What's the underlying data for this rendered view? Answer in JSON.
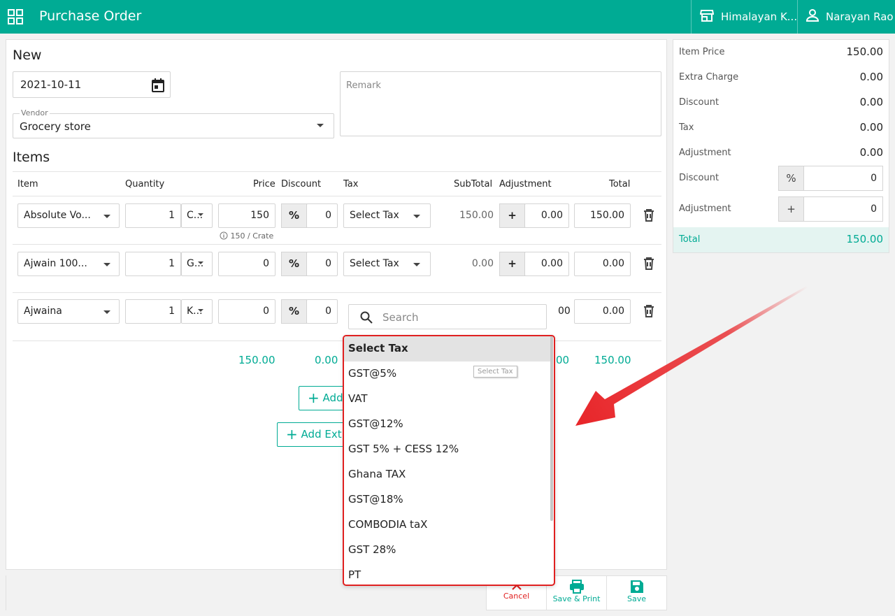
{
  "header": {
    "title": "Purchase Order",
    "store": "Himalayan K...",
    "user": "Narayan Rao"
  },
  "form": {
    "heading": "New",
    "date": "2021-10-11",
    "vendor_label": "Vendor",
    "vendor_value": "Grocery store",
    "remark_placeholder": "Remark"
  },
  "items": {
    "heading": "Items",
    "columns": [
      "Item",
      "Quantity",
      "Price",
      "Discount",
      "Tax",
      "SubTotal",
      "Adjustment",
      "Total"
    ],
    "rows": [
      {
        "item": "Absolute Vo...",
        "qty": "1",
        "unit": "C...",
        "price": "150",
        "disc_type": "%",
        "disc": "0",
        "tax": "Select Tax",
        "subtotal": "150.00",
        "adj_sign": "+",
        "adj": "0.00",
        "total": "150.00",
        "hint": "150 / Crate"
      },
      {
        "item": "Ajwain 100...",
        "qty": "1",
        "unit": "G...",
        "price": "0",
        "disc_type": "%",
        "disc": "0",
        "tax": "Select Tax",
        "subtotal": "0.00",
        "adj_sign": "+",
        "adj": "0.00",
        "total": "0.00"
      },
      {
        "item": "Ajwaina",
        "qty": "1",
        "unit": "K...",
        "price": "0",
        "disc_type": "%",
        "disc": "0",
        "adj_partial": "00",
        "total": "0.00"
      }
    ],
    "totals": {
      "price": "150.00",
      "discount": "0.00",
      "adjustment_partial": "00",
      "total": "150.00"
    },
    "add_item_label": "Add",
    "add_extra_label": "Add Ext"
  },
  "summary": {
    "rows": [
      {
        "label": "Item Price",
        "value": "150.00"
      },
      {
        "label": "Extra Charge",
        "value": "0.00"
      },
      {
        "label": "Discount",
        "value": "0.00"
      },
      {
        "label": "Tax",
        "value": "0.00"
      },
      {
        "label": "Adjustment",
        "value": "0.00"
      }
    ],
    "discount_label": "Discount",
    "discount_prefix": "%",
    "discount_value": "0",
    "adjustment_label": "Adjustment",
    "adjustment_prefix": "+",
    "adjustment_value": "0",
    "total_label": "Total",
    "total_value": "150.00"
  },
  "actions": {
    "cancel": "Cancel",
    "save_print": "Save & Print",
    "save": "Save"
  },
  "tax_dropdown": {
    "search_placeholder": "Search",
    "options": [
      "Select Tax",
      "GST@5%",
      "VAT",
      "GST@12%",
      "GST 5% + CESS 12%",
      "Ghana TAX",
      "GST@18%",
      "COMBODIA taX",
      "GST 28%",
      "PT"
    ],
    "selected_index": 0,
    "tooltip": "Select Tax"
  },
  "colors": {
    "brand": "#00ab94",
    "danger": "#e02020",
    "arrow": "#e8262a"
  }
}
